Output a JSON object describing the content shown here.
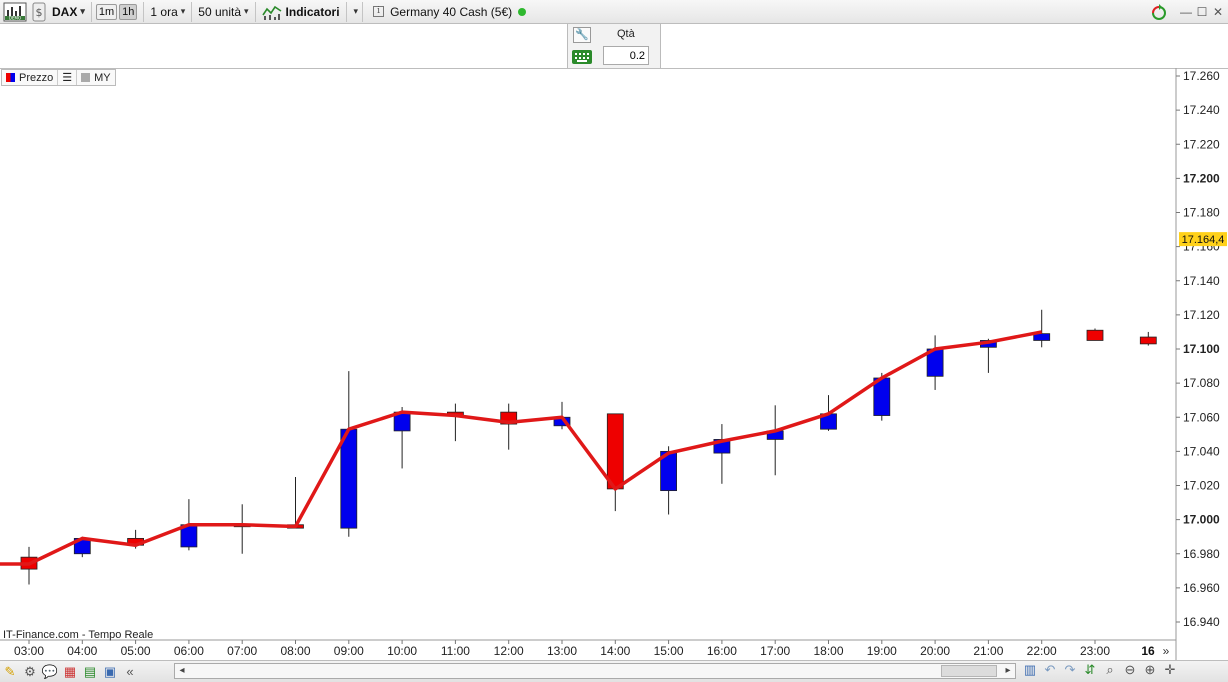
{
  "toolbar": {
    "instrument": "DAX",
    "tf_short": [
      "1m",
      "1h"
    ],
    "timeframe": "1 ora",
    "units": "50 unità",
    "indicators_label": "Indicatori",
    "market_name": "Germany 40 Cash (5€)",
    "demo_badge": "DEMO",
    "status_color": "#2eb82e"
  },
  "order_panel": {
    "qty_label": "Qtà",
    "qty_value": "0.2"
  },
  "legend": {
    "price": "Prezzo",
    "my": "MY"
  },
  "source": "IT-Finance.com - Tempo Reale",
  "date_marker": "16",
  "current_price_label": "17.164,4",
  "colors": {
    "bull": "#0000ee",
    "bear": "#ee0000",
    "line": "#e01818",
    "price_tag": "#ffd11a"
  },
  "chart_data": {
    "type": "candlestick",
    "y_axis": {
      "min": 16.93,
      "max": 17.26,
      "ticks": [
        "17.260",
        "17.240",
        "17.220",
        "17.200",
        "17.180",
        "17.160",
        "17.140",
        "17.120",
        "17.100",
        "17.080",
        "17.060",
        "17.040",
        "17.020",
        "17.000",
        "16.980",
        "16.960",
        "16.940"
      ],
      "tick_values": [
        17260,
        17240,
        17220,
        17200,
        17180,
        17160,
        17140,
        17120,
        17100,
        17080,
        17060,
        17040,
        17020,
        17000,
        16980,
        16960,
        16940
      ],
      "bold_ticks": [
        "17.200",
        "17.100",
        "17.000"
      ]
    },
    "x_axis": {
      "labels": [
        "03:00",
        "04:00",
        "05:00",
        "06:00",
        "07:00",
        "08:00",
        "09:00",
        "10:00",
        "11:00",
        "12:00",
        "13:00",
        "14:00",
        "15:00",
        "16:00",
        "17:00",
        "18:00",
        "19:00",
        "20:00",
        "21:00",
        "22:00",
        "23:00"
      ]
    },
    "current_price": 17164.4,
    "candles": [
      {
        "t": "03:00",
        "o": 16978,
        "h": 16984,
        "l": 16962,
        "c": 16971
      },
      {
        "t": "04:00",
        "o": 16980,
        "h": 16990,
        "l": 16978,
        "c": 16989
      },
      {
        "t": "05:00",
        "o": 16989,
        "h": 16994,
        "l": 16983,
        "c": 16985
      },
      {
        "t": "06:00",
        "o": 16984,
        "h": 17012,
        "l": 16982,
        "c": 16997
      },
      {
        "t": "07:00",
        "o": 16997,
        "h": 17009,
        "l": 16980,
        "c": 16996
      },
      {
        "t": "08:00",
        "o": 16997,
        "h": 17025,
        "l": 16995,
        "c": 16995
      },
      {
        "t": "09:00",
        "o": 16995,
        "h": 17087,
        "l": 16990,
        "c": 17053
      },
      {
        "t": "10:00",
        "o": 17052,
        "h": 17066,
        "l": 17030,
        "c": 17063
      },
      {
        "t": "11:00",
        "o": 17063,
        "h": 17068,
        "l": 17046,
        "c": 17061
      },
      {
        "t": "12:00",
        "o": 17063,
        "h": 17068,
        "l": 17041,
        "c": 17056
      },
      {
        "t": "13:00",
        "o": 17055,
        "h": 17069,
        "l": 17053,
        "c": 17060
      },
      {
        "t": "14:00",
        "o": 17062,
        "h": 17062,
        "l": 17005,
        "c": 17018
      },
      {
        "t": "15:00",
        "o": 17017,
        "h": 17043,
        "l": 17003,
        "c": 17040
      },
      {
        "t": "16:00",
        "o": 17039,
        "h": 17056,
        "l": 17021,
        "c": 17047
      },
      {
        "t": "17:00",
        "o": 17047,
        "h": 17067,
        "l": 17026,
        "c": 17052
      },
      {
        "t": "18:00",
        "o": 17053,
        "h": 17073,
        "l": 17052,
        "c": 17062
      },
      {
        "t": "19:00",
        "o": 17061,
        "h": 17086,
        "l": 17058,
        "c": 17083
      },
      {
        "t": "20:00",
        "o": 17084,
        "h": 17108,
        "l": 17076,
        "c": 17100
      },
      {
        "t": "21:00",
        "o": 17101,
        "h": 17106,
        "l": 17086,
        "c": 17105
      },
      {
        "t": "22:00",
        "o": 17105,
        "h": 17123,
        "l": 17101,
        "c": 17109
      },
      {
        "t": "23:00",
        "o": 17111,
        "h": 17112,
        "l": 17105,
        "c": 17105
      },
      {
        "t": "next",
        "o": 17107,
        "h": 17110,
        "l": 17102,
        "c": 17103
      }
    ],
    "series": [
      {
        "name": "MY",
        "values": [
          16974,
          16989,
          16985,
          16997,
          16997,
          16996,
          17053,
          17063,
          17061,
          17057,
          17060,
          17018,
          17039,
          17046,
          17052,
          17062,
          17083,
          17100,
          17104,
          17110
        ]
      }
    ]
  }
}
